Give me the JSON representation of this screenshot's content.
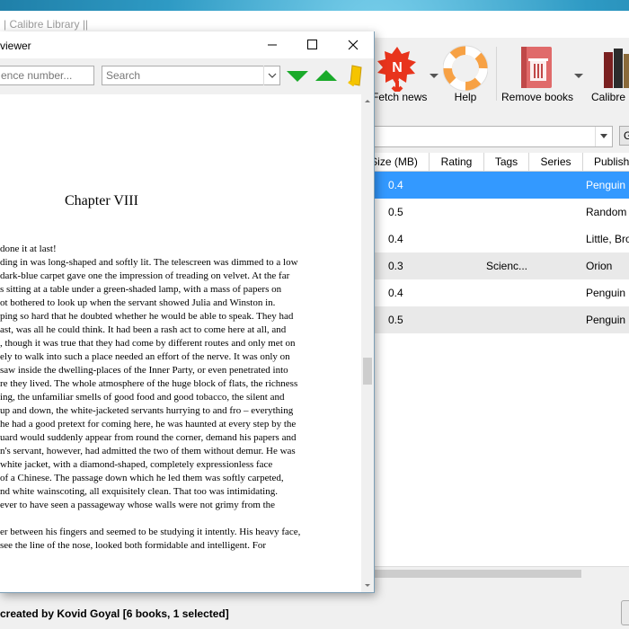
{
  "calibre": {
    "title": "| Calibre Library ||",
    "toolbar": [
      {
        "label": "Fetch news",
        "icon": "fetch-news-icon"
      },
      {
        "label": "Help",
        "icon": "help-lifebuoy-icon"
      },
      {
        "label": "Remove books",
        "icon": "remove-books-icon"
      },
      {
        "label": "Calibre L",
        "icon": "calibre-library-icon"
      }
    ],
    "go_label": "G",
    "columns": [
      "Size (MB)",
      "Rating",
      "Tags",
      "Series",
      "Publish"
    ],
    "rows": [
      {
        "size": "0.4",
        "tags": "",
        "publisher": "Penguin U"
      },
      {
        "size": "0.5",
        "tags": "",
        "publisher": "Random"
      },
      {
        "size": "0.4",
        "tags": "",
        "publisher": "Little, Bro"
      },
      {
        "size": "0.3",
        "tags": "Scienc...",
        "publisher": "Orion"
      },
      {
        "size": "0.4",
        "tags": "",
        "publisher": "Penguin U"
      },
      {
        "size": "0.5",
        "tags": "",
        "publisher": "Penguin U"
      }
    ],
    "status": "created by Kovid Goyal    [6 books, 1 selected]"
  },
  "viewer": {
    "title": "viewer",
    "reference_placeholder": "ence number...",
    "search_placeholder": "Search",
    "chapter": "Chapter VIII",
    "lines": [
      "done it at last!",
      "ding in was long-shaped and softly lit. The telescreen was dimmed to a low",
      "dark-blue carpet gave one the impression of treading on velvet. At the far",
      "s sitting at a table under a green-shaded lamp, with a mass of papers on",
      "ot bothered to look up when the servant showed Julia and Winston in.",
      "ping so hard that he doubted whether he would be able to speak. They had",
      "ast, was all he could think. It had been a rash act to come here at all, and",
      ", though it was true that they had come by different routes and only met on",
      "ely to walk into such a place needed an effort of the nerve. It was only on",
      "saw inside the dwelling-places of the Inner Party, or even penetrated into",
      "re they lived. The whole atmosphere of the huge block of flats, the richness",
      "ing, the unfamiliar smells of good food and good tobacco, the silent and",
      "up and down, the white-jacketed servants hurrying to and fro – everything",
      "he had a good pretext for coming here, he was haunted at every step by the",
      "uard would suddenly appear from round the corner, demand his papers and",
      "n's servant, however, had admitted the two of them without demur. He was",
      " white jacket, with a diamond-shaped, completely expressionless face",
      "of a Chinese. The passage down which he led them was softly carpeted,",
      "nd white wainscoting, all exquisitely clean. That too was intimidating.",
      " ever to have seen a passageway whose walls were not grimy from the",
      "",
      "er between his fingers and seemed to be studying it intently. His heavy face,",
      " see the line of the nose, looked both formidable and intelligent. For"
    ]
  },
  "colors": {
    "selection": "#3399ff",
    "alt_row": "#e9e9e9",
    "arrow_green": "#1aaa2a",
    "fetch_red": "#e8341c"
  }
}
